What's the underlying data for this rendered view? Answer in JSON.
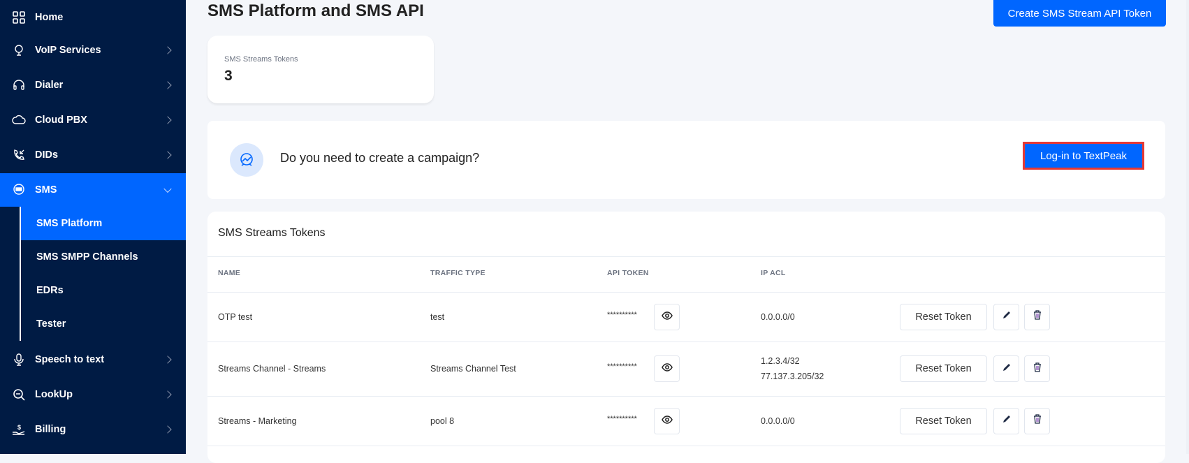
{
  "sidebar": {
    "items": [
      {
        "label": "Home",
        "icon": "grid-icon"
      },
      {
        "label": "VoIP Services",
        "icon": "globe-icon"
      },
      {
        "label": "Dialer",
        "icon": "headset-icon"
      },
      {
        "label": "Cloud PBX",
        "icon": "cloud-phone-icon"
      },
      {
        "label": "DIDs",
        "icon": "incoming-call-icon"
      },
      {
        "label": "SMS",
        "icon": "chat-icon"
      },
      {
        "label": "Speech to text",
        "icon": "microphone-icon"
      },
      {
        "label": "LookUp",
        "icon": "search-icon"
      },
      {
        "label": "Billing",
        "icon": "hand-dollar-icon"
      }
    ],
    "sms_sub": [
      "SMS Platform",
      "SMS SMPP Channels",
      "EDRs",
      "Tester"
    ]
  },
  "page": {
    "title": "SMS Platform and SMS API",
    "create_button": "Create SMS Stream API Token"
  },
  "stat": {
    "label": "SMS Streams Tokens",
    "value": "3"
  },
  "campaign": {
    "question": "Do you need to create a campaign?",
    "button": "Log-in to TextPeak"
  },
  "tokens": {
    "title": "SMS Streams Tokens",
    "columns": [
      "NAME",
      "TRAFFIC TYPE",
      "API TOKEN",
      "IP ACL"
    ],
    "reset_label": "Reset Token",
    "rows": [
      {
        "name": "OTP test",
        "traffic": "test",
        "token": "**********",
        "acl": [
          "0.0.0.0/0"
        ]
      },
      {
        "name": "Streams Channel - Streams",
        "traffic": "Streams Channel Test",
        "token": "**********",
        "acl": [
          "1.2.3.4/32",
          "77.137.3.205/32"
        ]
      },
      {
        "name": "Streams - Marketing",
        "traffic": "pool 8",
        "token": "**********",
        "acl": [
          "0.0.0.0/0"
        ]
      }
    ]
  },
  "colors": {
    "sidebar": "#001b44",
    "accent": "#0066ff",
    "highlight": "#e53935"
  }
}
